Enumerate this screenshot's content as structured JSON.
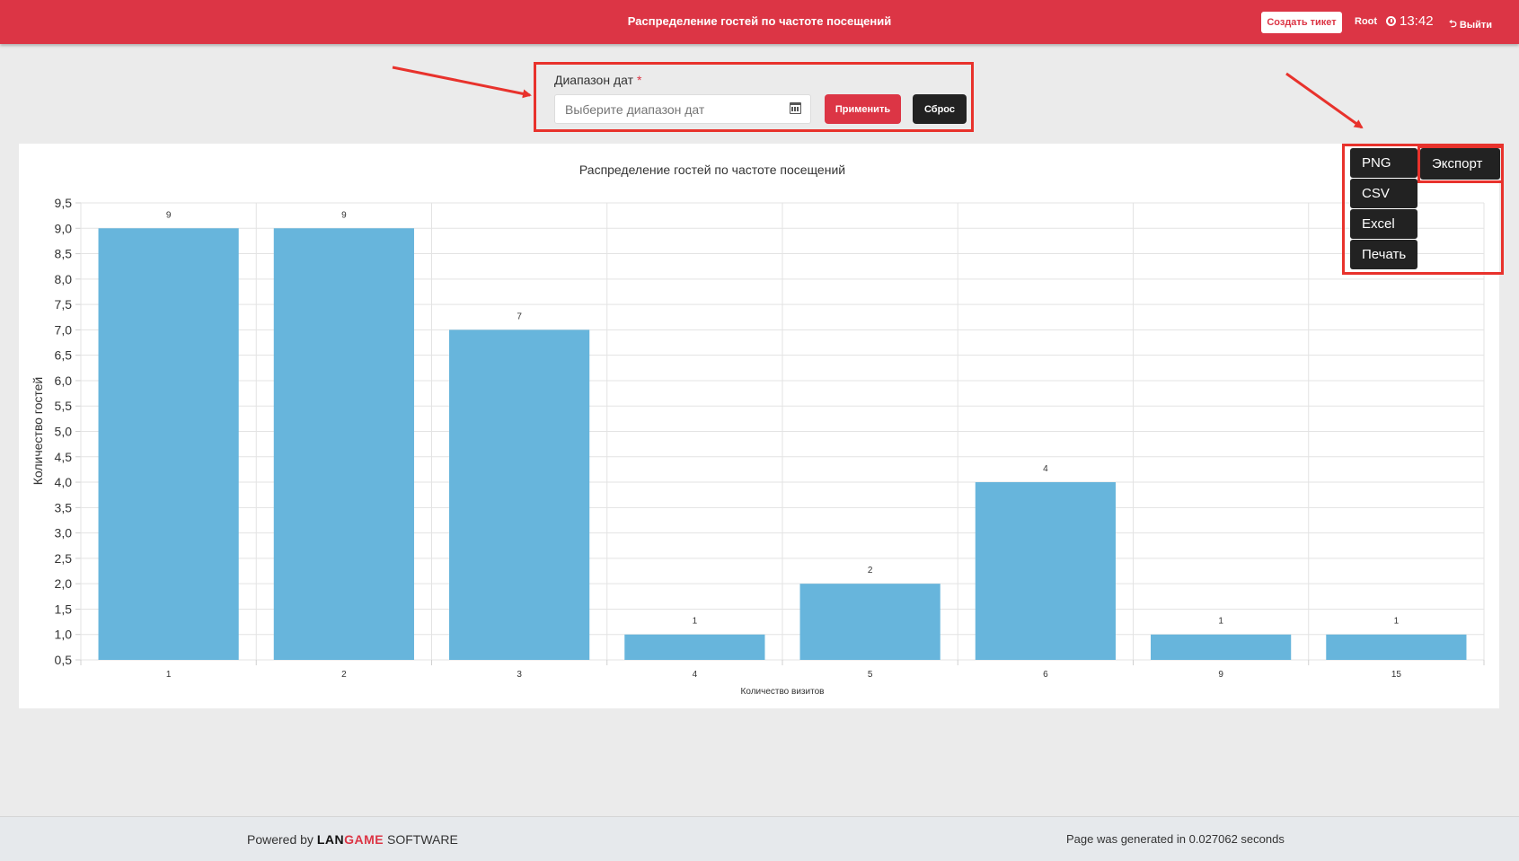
{
  "header": {
    "title": "Распределение гостей по частоте посещений",
    "ticket_label": "Создать тикет",
    "user": "Root",
    "time": "13:42",
    "logout_label": "Выйти"
  },
  "filter": {
    "label": "Диапазон дат",
    "required_mark": "*",
    "date_placeholder": "Выберите диапазон дат",
    "apply_label": "Применить",
    "reset_label": "Сброс"
  },
  "export_menu": {
    "main_label": "Экспорт",
    "options": [
      "PNG",
      "CSV",
      "Excel",
      "Печать"
    ]
  },
  "chart_data": {
    "type": "bar",
    "title": "Распределение гостей по частоте посещений",
    "xlabel": "Количество визитов",
    "ylabel": "Количество гостей",
    "categories": [
      "1",
      "2",
      "3",
      "4",
      "5",
      "6",
      "9",
      "15"
    ],
    "values": [
      9,
      9,
      7,
      1,
      2,
      4,
      1,
      1
    ],
    "ylim": [
      0.5,
      9.5
    ],
    "yticks": [
      "0,5",
      "1,0",
      "1,5",
      "2,0",
      "2,5",
      "3,0",
      "3,5",
      "4,0",
      "4,5",
      "5,0",
      "5,5",
      "6,0",
      "6,5",
      "7,0",
      "7,5",
      "8,0",
      "8,5",
      "9,0",
      "9,5"
    ],
    "grid": true,
    "data_labels": true,
    "bar_color": "#67b5dc"
  },
  "footer": {
    "powered_prefix": "Powered by",
    "brand_part1": "LAN",
    "brand_part2": "GAME",
    "brand_suffix": "SOFTWARE",
    "generated_text": "Page was generated in 0.027062 seconds"
  },
  "colors": {
    "header_bg": "#dc3545",
    "annotation": "#e8322c",
    "dark_button": "#222222"
  }
}
